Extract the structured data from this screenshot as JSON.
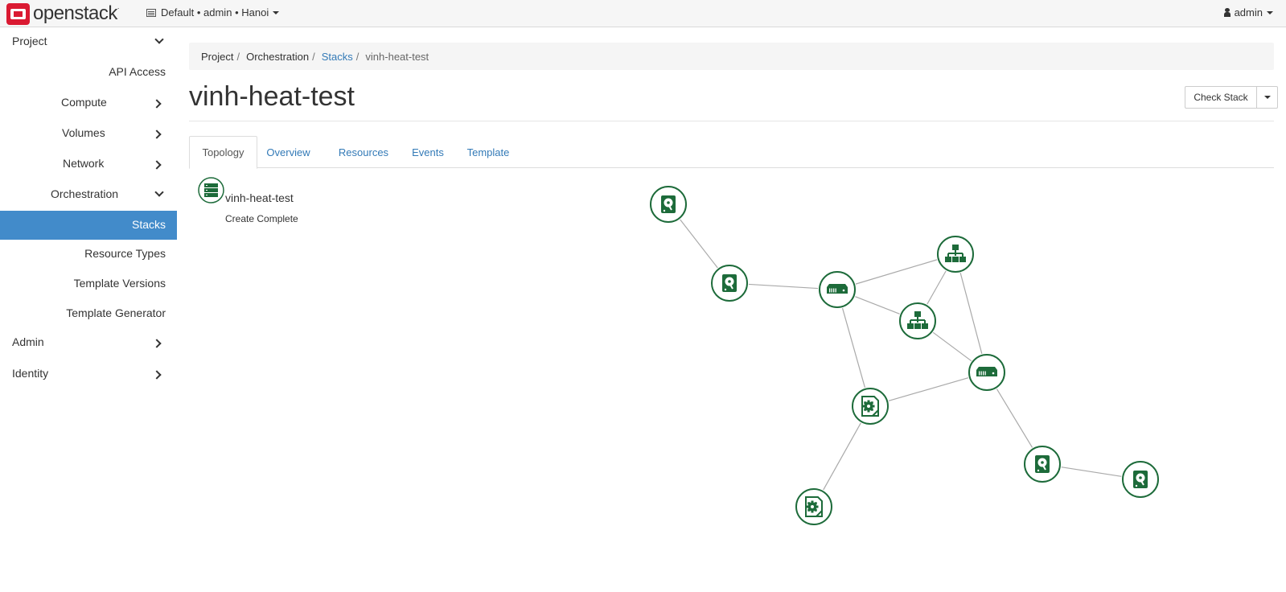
{
  "brand": {
    "name": "openstack",
    "mark": "."
  },
  "context": {
    "domain": "Default",
    "project": "admin",
    "region": "Hanoi",
    "separator": "•"
  },
  "user": {
    "name": "admin"
  },
  "sidebar": {
    "project": "Project",
    "api_access": "API Access",
    "compute": "Compute",
    "volumes": "Volumes",
    "network": "Network",
    "orchestration": "Orchestration",
    "stacks": "Stacks",
    "resource_types": "Resource Types",
    "template_versions": "Template Versions",
    "template_generator": "Template Generator",
    "admin": "Admin",
    "identity": "Identity"
  },
  "breadcrumb": {
    "project": "Project",
    "orchestration": "Orchestration",
    "stacks": "Stacks",
    "current": "vinh-heat-test",
    "separator": "/"
  },
  "page": {
    "title": "vinh-heat-test"
  },
  "actions": {
    "check_stack": "Check Stack"
  },
  "tabs": {
    "topology": "Topology",
    "overview": "Overview",
    "resources": "Resources",
    "events": "Events",
    "template": "Template"
  },
  "stack": {
    "name": "vinh-heat-test",
    "status": "Create Complete"
  },
  "topology": {
    "accent_color": "#1d6b3a",
    "nodes": [
      {
        "id": "volume-1",
        "icon": "volume-icon"
      },
      {
        "id": "volume-2",
        "icon": "volume-icon"
      },
      {
        "id": "server-1",
        "icon": "server-icon"
      },
      {
        "id": "network-1",
        "icon": "network-icon"
      },
      {
        "id": "network-2",
        "icon": "network-icon"
      },
      {
        "id": "server-2",
        "icon": "server-icon"
      },
      {
        "id": "config-1",
        "icon": "software-config-icon"
      },
      {
        "id": "config-2",
        "icon": "software-config-icon"
      },
      {
        "id": "volume-3",
        "icon": "volume-icon"
      },
      {
        "id": "volume-4",
        "icon": "volume-icon"
      }
    ],
    "links": [
      [
        "volume-1",
        "volume-2"
      ],
      [
        "volume-2",
        "server-1"
      ],
      [
        "server-1",
        "network-1"
      ],
      [
        "server-1",
        "network-2"
      ],
      [
        "network-1",
        "network-2"
      ],
      [
        "network-1",
        "server-2"
      ],
      [
        "network-2",
        "server-2"
      ],
      [
        "server-1",
        "config-1"
      ],
      [
        "config-1",
        "server-2"
      ],
      [
        "config-1",
        "config-2"
      ],
      [
        "server-2",
        "volume-3"
      ],
      [
        "volume-3",
        "volume-4"
      ]
    ]
  }
}
